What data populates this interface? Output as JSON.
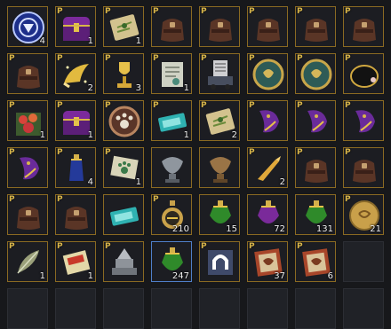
{
  "inventory": {
    "columns": 8,
    "slots": [
      {
        "icon": "blue-emblem-icon",
        "p": false,
        "qty": "4"
      },
      {
        "icon": "purple-chest-icon",
        "p": true,
        "qty": "1"
      },
      {
        "icon": "map-scroll-icon",
        "p": true,
        "qty": "1"
      },
      {
        "icon": "leather-bag-icon",
        "p": true,
        "qty": ""
      },
      {
        "icon": "leather-bag-icon",
        "p": true,
        "qty": ""
      },
      {
        "icon": "leather-bag-icon",
        "p": true,
        "qty": ""
      },
      {
        "icon": "leather-bag-icon",
        "p": true,
        "qty": ""
      },
      {
        "icon": "leather-bag-icon",
        "p": true,
        "qty": ""
      },
      {
        "icon": "leather-bag-icon",
        "p": true,
        "qty": ""
      },
      {
        "icon": "golden-horn-icon",
        "p": true,
        "qty": "2"
      },
      {
        "icon": "golden-trophy-icon",
        "p": true,
        "qty": "3"
      },
      {
        "icon": "document-scroll-icon",
        "p": true,
        "qty": "1"
      },
      {
        "icon": "cart-icon",
        "p": true,
        "qty": ""
      },
      {
        "icon": "coin-medallion-icon",
        "p": true,
        "qty": ""
      },
      {
        "icon": "coin-medallion-icon",
        "p": true,
        "qty": ""
      },
      {
        "icon": "black-pouch-icon",
        "p": true,
        "qty": ""
      },
      {
        "icon": "flower-box-icon",
        "p": true,
        "qty": "1"
      },
      {
        "icon": "purple-chest-icon",
        "p": true,
        "qty": "1"
      },
      {
        "icon": "paw-coin-icon",
        "p": true,
        "qty": ""
      },
      {
        "icon": "teal-ticket-icon",
        "p": true,
        "qty": "1"
      },
      {
        "icon": "map-scroll-icon",
        "p": true,
        "qty": "2"
      },
      {
        "icon": "purple-crest-icon",
        "p": true,
        "qty": ""
      },
      {
        "icon": "purple-crest-icon",
        "p": true,
        "qty": ""
      },
      {
        "icon": "purple-crest-icon",
        "p": true,
        "qty": ""
      },
      {
        "icon": "purple-crest-icon",
        "p": true,
        "qty": ""
      },
      {
        "icon": "blue-potion-icon",
        "p": true,
        "qty": "4"
      },
      {
        "icon": "paw-scroll-icon",
        "p": true,
        "qty": "1"
      },
      {
        "icon": "silver-bird-statue-icon",
        "p": false,
        "qty": ""
      },
      {
        "icon": "bronze-bird-statue-icon",
        "p": false,
        "qty": ""
      },
      {
        "icon": "golden-claw-icon",
        "p": true,
        "qty": "2"
      },
      {
        "icon": "leather-bag-icon",
        "p": true,
        "qty": ""
      },
      {
        "icon": "leather-bag-icon",
        "p": true,
        "qty": ""
      },
      {
        "icon": "leather-bag-icon",
        "p": true,
        "qty": ""
      },
      {
        "icon": "leather-bag-icon",
        "p": true,
        "qty": ""
      },
      {
        "icon": "teal-ticket-icon",
        "p": false,
        "qty": ""
      },
      {
        "icon": "gold-flask-icon",
        "p": true,
        "qty": "210"
      },
      {
        "icon": "green-potion-icon",
        "p": false,
        "qty": "15"
      },
      {
        "icon": "purple-potion-icon",
        "p": false,
        "qty": "72"
      },
      {
        "icon": "green-potion-icon",
        "p": false,
        "qty": "131"
      },
      {
        "icon": "gold-coin-icon",
        "p": true,
        "qty": "21"
      },
      {
        "icon": "feather-icon",
        "p": true,
        "qty": "1"
      },
      {
        "icon": "card-ticket-icon",
        "p": true,
        "qty": "1"
      },
      {
        "icon": "stone-altar-icon",
        "p": true,
        "qty": ""
      },
      {
        "icon": "green-potion-icon",
        "p": false,
        "qty": "247",
        "selected": true
      },
      {
        "icon": "horseshoe-banner-icon",
        "p": true,
        "qty": ""
      },
      {
        "icon": "red-scroll-icon",
        "p": true,
        "qty": "37"
      },
      {
        "icon": "red-scroll-icon",
        "p": true,
        "qty": "6"
      },
      {
        "icon": "empty-slot",
        "p": false,
        "qty": "",
        "empty": true
      },
      {
        "icon": "empty-slot",
        "p": false,
        "qty": "",
        "empty": true
      },
      {
        "icon": "empty-slot",
        "p": false,
        "qty": "",
        "empty": true
      },
      {
        "icon": "empty-slot",
        "p": false,
        "qty": "",
        "empty": true
      },
      {
        "icon": "empty-slot",
        "p": false,
        "qty": "",
        "empty": true
      },
      {
        "icon": "empty-slot",
        "p": false,
        "qty": "",
        "empty": true
      },
      {
        "icon": "empty-slot",
        "p": false,
        "qty": "",
        "empty": true
      },
      {
        "icon": "empty-slot",
        "p": false,
        "qty": "",
        "empty": true
      },
      {
        "icon": "empty-slot",
        "p": false,
        "qty": "",
        "empty": true
      }
    ],
    "p_mark": "P"
  },
  "colors": {
    "slot_border": "#8a6a22",
    "selected_border": "#4f7fc9",
    "background": "#17181b"
  }
}
